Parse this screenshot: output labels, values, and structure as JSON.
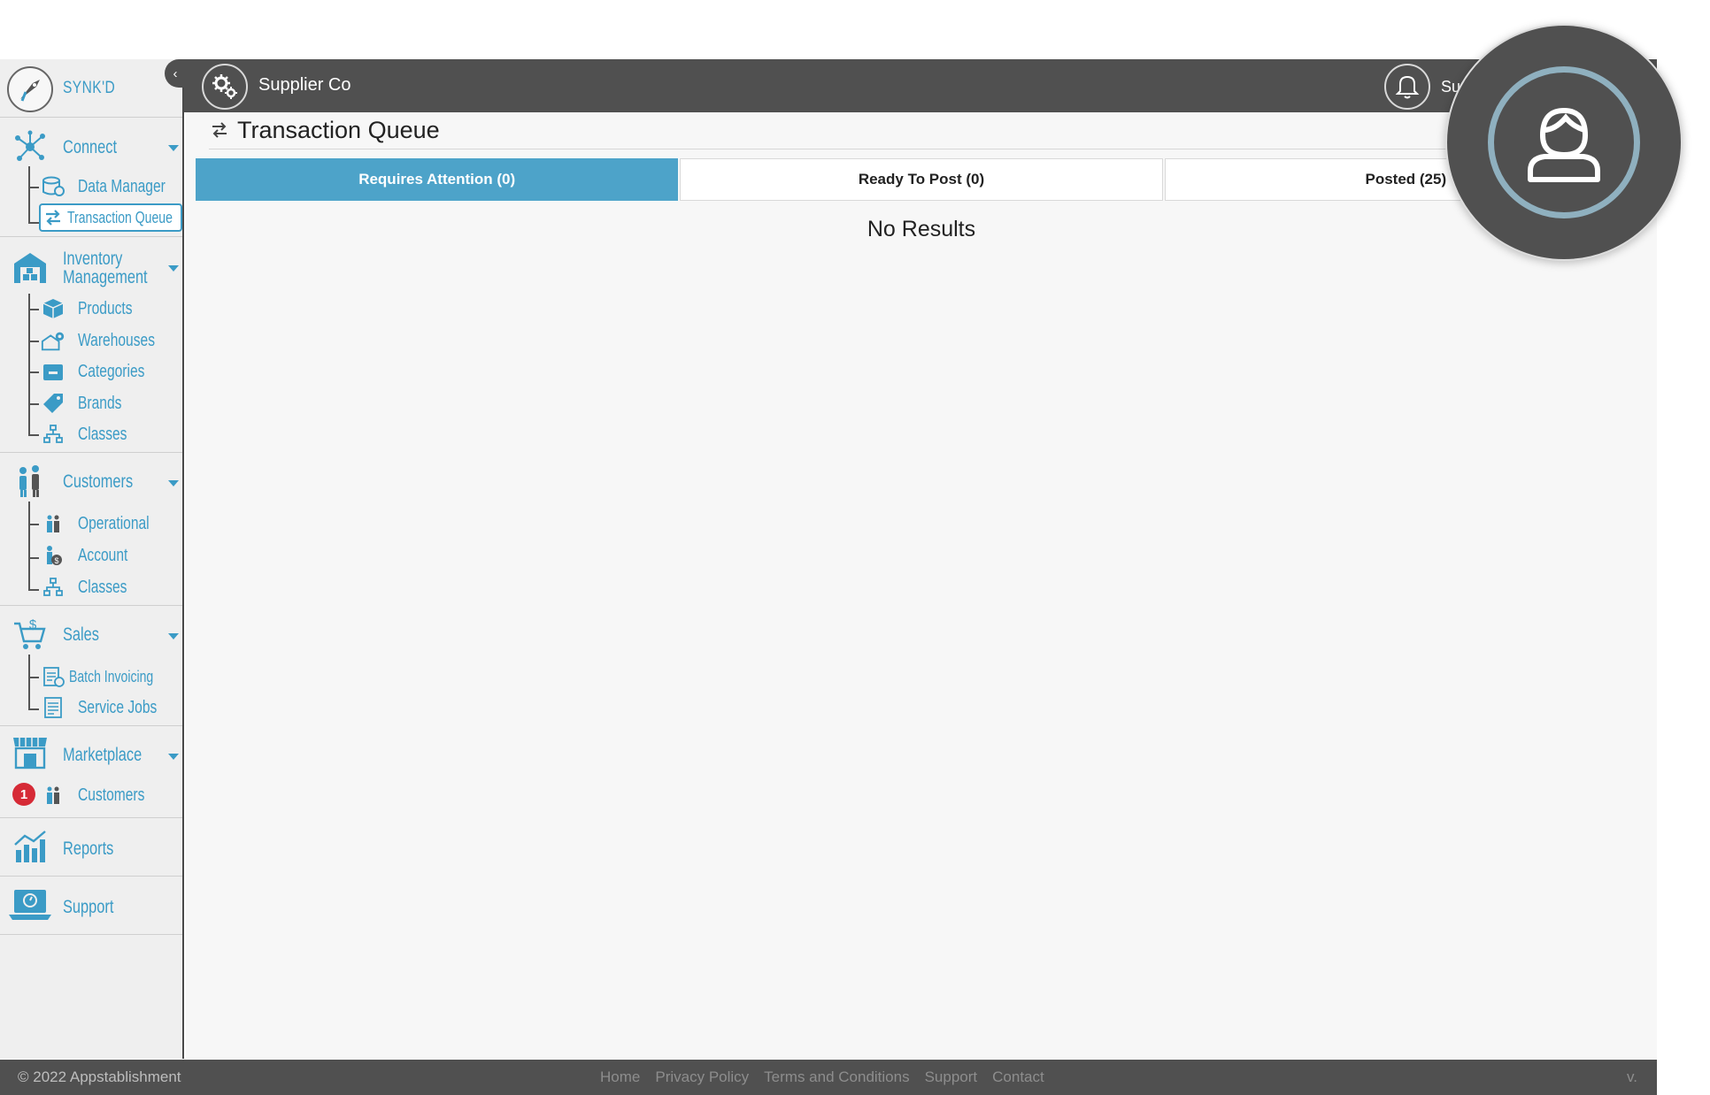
{
  "brand": {
    "name": "SYNK'D"
  },
  "header": {
    "org_name": "Supplier Co",
    "user_short": "Su"
  },
  "sidebar": {
    "connect": {
      "label": "Connect",
      "items": [
        "Data Manager",
        "Transaction Queue"
      ]
    },
    "inventory": {
      "label_line1": "Inventory",
      "label_line2": "Management",
      "items": [
        "Products",
        "Warehouses",
        "Categories",
        "Brands",
        "Classes"
      ]
    },
    "customers": {
      "label": "Customers",
      "items": [
        "Operational",
        "Account",
        "Classes"
      ]
    },
    "sales": {
      "label": "Sales",
      "items": [
        "Batch Invoicing",
        "Service Jobs"
      ]
    },
    "marketplace": {
      "label": "Marketplace",
      "items": [
        "Customers"
      ],
      "badge": "1"
    },
    "reports": {
      "label": "Reports"
    },
    "support": {
      "label": "Support"
    }
  },
  "main": {
    "title": "Transaction Queue",
    "tabs": [
      {
        "label": "Requires Attention (0)"
      },
      {
        "label": "Ready To Post (0)"
      },
      {
        "label": "Posted (25)"
      }
    ],
    "empty_message": "No Results"
  },
  "footer": {
    "copyright": "© 2022 Appstablishment",
    "links": [
      "Home",
      "Privacy Policy",
      "Terms and Conditions",
      "Support",
      "Contact"
    ],
    "version": "v."
  },
  "colors": {
    "accent": "#3b9bc6",
    "tab_active": "#4da3c9",
    "header_bg": "#505050",
    "badge": "#d62a36"
  }
}
